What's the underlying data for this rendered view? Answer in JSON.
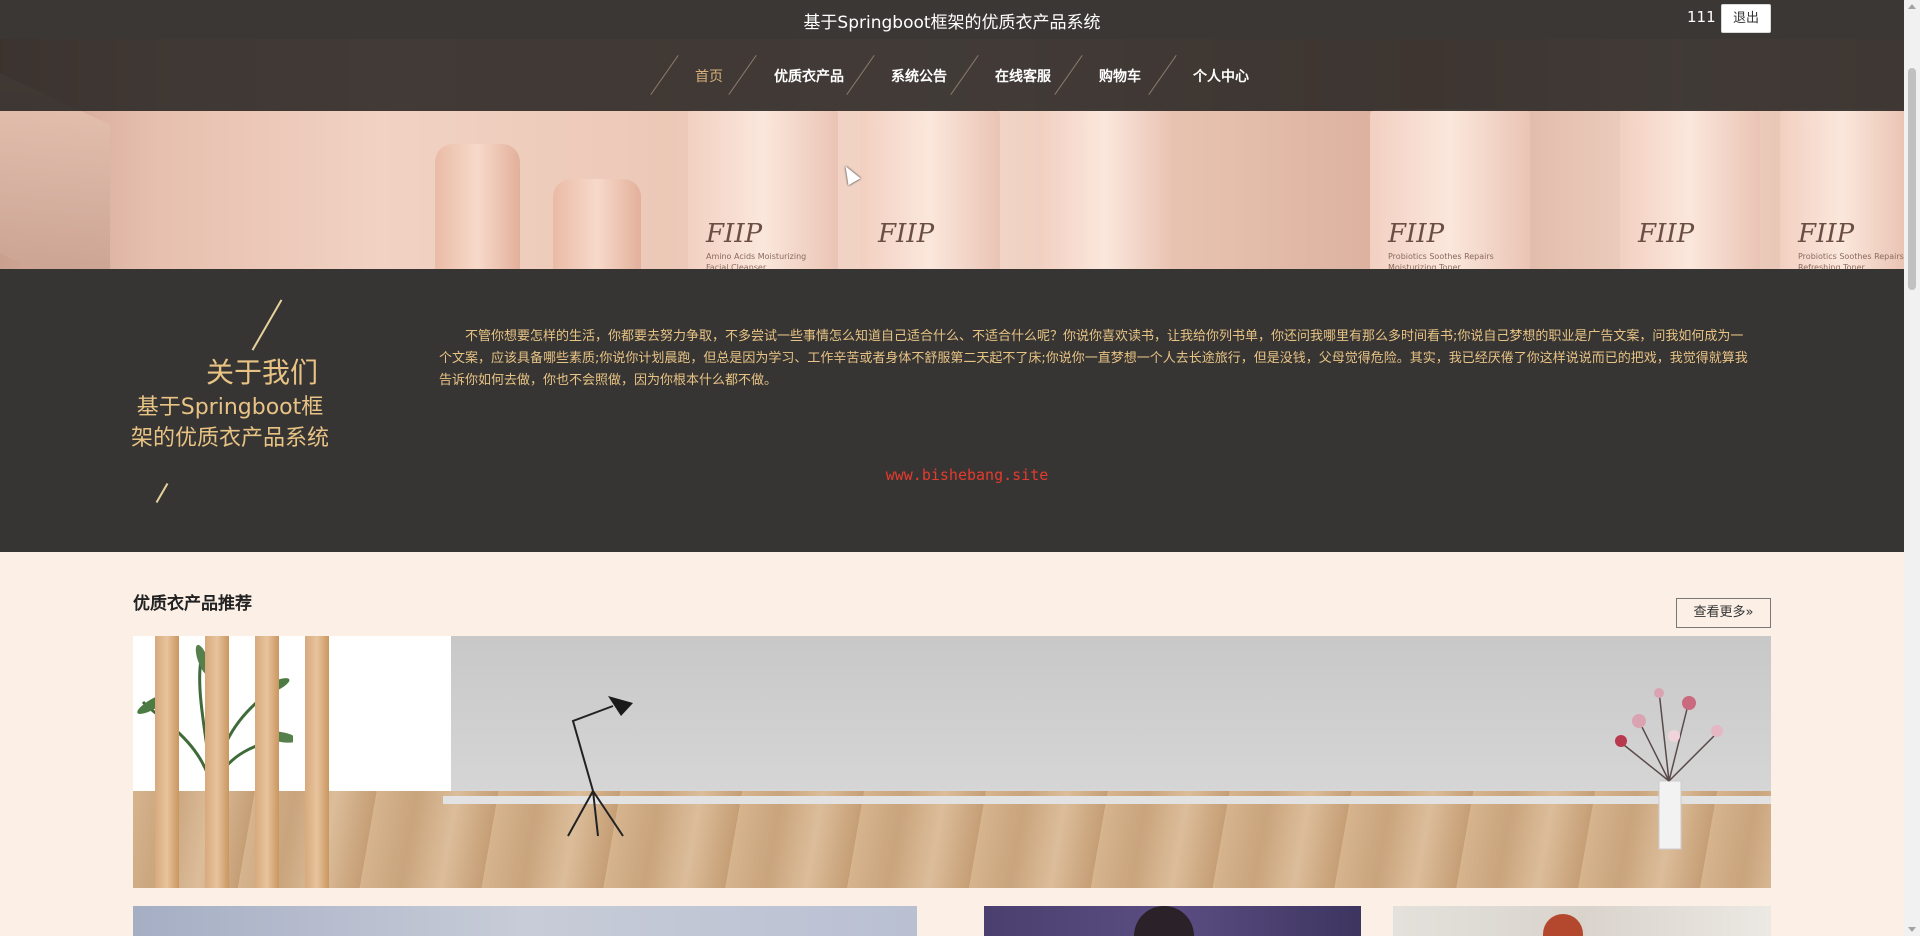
{
  "header": {
    "site_title": "基于Springboot框架的优质衣产品系统",
    "username": "111",
    "logout_label": "退出"
  },
  "nav": {
    "items": [
      {
        "label": "首页",
        "active": true
      },
      {
        "label": "优质衣产品",
        "active": false
      },
      {
        "label": "系统公告",
        "active": false
      },
      {
        "label": "在线客服",
        "active": false
      },
      {
        "label": "购物车",
        "active": false
      },
      {
        "label": "个人中心",
        "active": false
      }
    ]
  },
  "banner": {
    "brand_text": "FIIP",
    "tube_texts": [
      "Amino Acids Moisturizing Facial Cleanser",
      "Probiotics Soothes Repairs Moisturizing Toner",
      "Probiotics Soothes Repairs Refreshing Toner"
    ],
    "slide_index": 1
  },
  "about": {
    "heading": "关于我们",
    "subtitle": "基于Springboot框架的优质衣产品系统",
    "body": "不管你想要怎样的生活，你都要去努力争取，不多尝试一些事情怎么知道自己适合什么、不适合什么呢？你说你喜欢读书，让我给你列书单，你还问我哪里有那么多时间看书;你说自己梦想的职业是广告文案，问我如何成为一个文案，应该具备哪些素质;你说你计划晨跑，但总是因为学习、工作辛苦或者身体不舒服第二天起不了床;你说你一直梦想一个人去长途旅行，但是没钱，父母觉得危险。其实，我已经厌倦了你这样说说而已的把戏，我觉得就算我告诉你如何去做，你也不会照做，因为你根本什么都不做。",
    "watermark": "www.bishebang.site"
  },
  "recommend": {
    "title": "优质衣产品推荐",
    "more_label": "查看更多»"
  },
  "colors": {
    "topbar": "#3a3735",
    "about_bg": "#363534",
    "accent_gold": "#e8c384",
    "page_bg": "#fbefe6",
    "watermark_red": "#e63a2e"
  }
}
